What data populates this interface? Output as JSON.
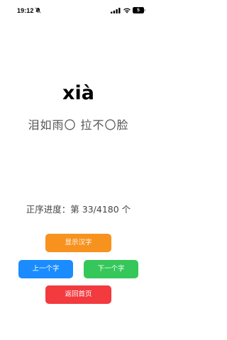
{
  "status_bar": {
    "time": "19:12",
    "battery_level": "5",
    "icons": [
      "bell-off-icon",
      "cellular-signal-icon",
      "wifi-icon",
      "battery-icon"
    ]
  },
  "card": {
    "pinyin": "xià",
    "phrase": "泪如雨〇 拉不〇脸"
  },
  "progress": {
    "text": "正序进度：第 33/4180 个",
    "current": 33,
    "total": 4180
  },
  "buttons": {
    "show_hanzi": "显示汉字",
    "previous": "上一个字",
    "next": "下一个字",
    "home": "返回首页"
  },
  "colors": {
    "show_hanzi": "#f7921e",
    "previous": "#1a8cff",
    "next": "#35c759",
    "home": "#f23a3f"
  }
}
